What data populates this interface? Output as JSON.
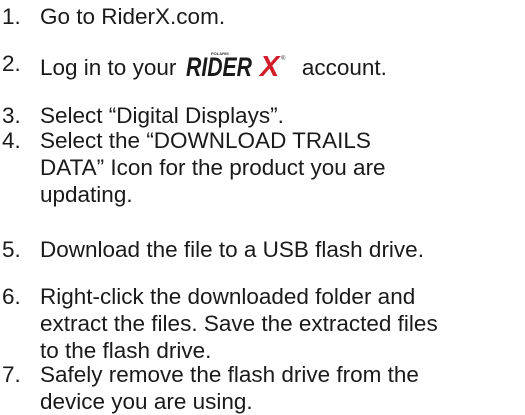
{
  "steps": [
    {
      "number": "1.",
      "lines": [
        "Go to RiderX.com."
      ]
    },
    {
      "number": "2.",
      "before_logo": "Log in to your",
      "logo": {
        "text": "RIDERX",
        "small_text": "POLARIS",
        "color": "#d01f2b",
        "tm": "®"
      },
      "after_logo": "account."
    },
    {
      "number": "3.",
      "lines": [
        "Select “Digital Displays”."
      ]
    },
    {
      "number": "4.",
      "lines": [
        "Select the “DOWNLOAD TRAILS",
        "DATA” Icon for the product you are",
        "updating."
      ]
    },
    {
      "number": "5.",
      "lines": [
        "Download the file to a USB flash drive."
      ]
    },
    {
      "number": "6.",
      "lines": [
        "Right-click the downloaded folder and",
        "extract the files. Save the extracted files",
        "to the flash drive."
      ]
    },
    {
      "number": "7.",
      "lines": [
        "Safely remove the flash drive from the",
        "device you are using."
      ]
    }
  ]
}
